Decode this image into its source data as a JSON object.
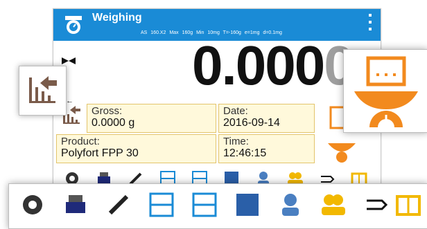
{
  "header": {
    "title": "Weighing",
    "meta": "AS 160.X2 Max 160g Min 10mg T=-160g e=1mg d=0.1mg"
  },
  "reading": {
    "main": "0.000",
    "dim": "0"
  },
  "tare_marker": "0←",
  "fields": {
    "gross": {
      "label": "Gross:",
      "value": "0.0000 g"
    },
    "date": {
      "label": "Date:",
      "value": "2016-09-14"
    },
    "product": {
      "label": "Product:",
      "value": "Polyfort FPP 30"
    },
    "time": {
      "label": "Time:",
      "value": "12:46:15"
    }
  },
  "toolbar": [
    "settings-icon",
    "print-icon",
    "tools-icon",
    "tare-grid-icon",
    "tare-grid-icon-2",
    "stat-icon",
    "user-icon",
    "users-icon",
    "unit-icon",
    "database-icon"
  ],
  "colors": {
    "header": "#1a8bd6",
    "field_bg": "#fff9db",
    "field_border": "#e3c46b",
    "orange": "#f28a1e",
    "brown": "#7a5b4a"
  }
}
